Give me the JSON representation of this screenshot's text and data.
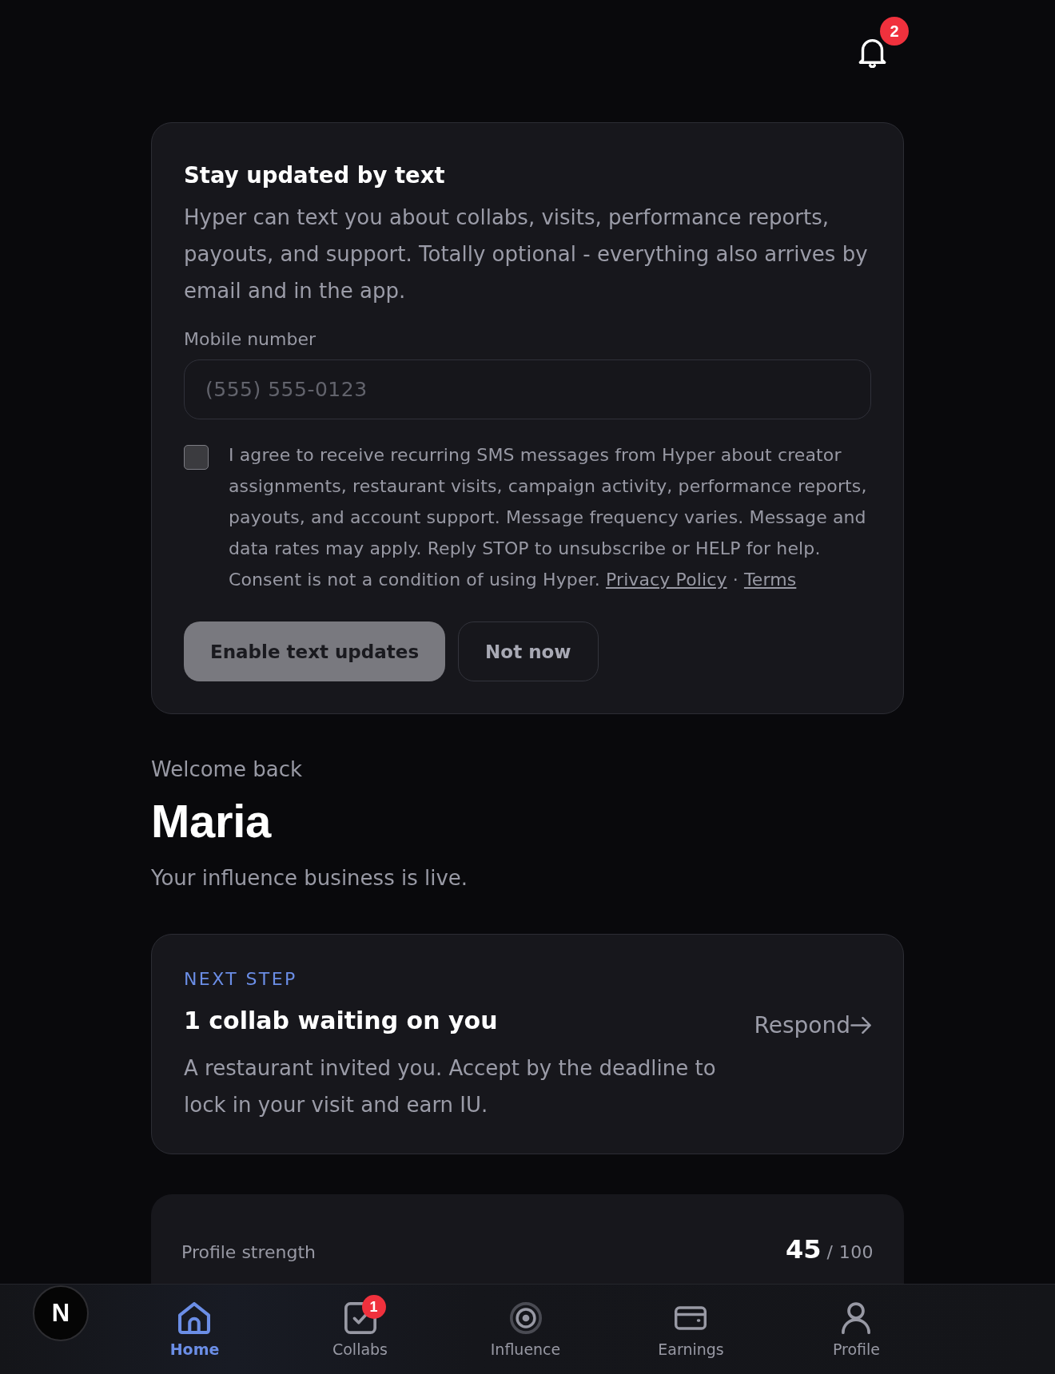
{
  "header": {
    "notifications": {
      "count": "2"
    }
  },
  "sms_card": {
    "title": "Stay updated by text",
    "description": "Hyper can text you about collabs, visits, performance reports, payouts, and support. Totally optional - everything also arrives by email and in the app.",
    "phone_field": {
      "label": "Mobile number",
      "placeholder": "(555) 555-0123"
    },
    "consent": {
      "checked": false,
      "text": "I agree to receive recurring SMS messages from Hyper about creator assignments, restaurant visits, campaign activity, performance reports, payouts, and account support. Message frequency varies. Message and data rates may apply. Reply STOP to unsubscribe or HELP for help. Consent is not a condition of using Hyper.",
      "links": [
        "Privacy Policy",
        "Terms"
      ],
      "separator": "·"
    },
    "buttons": [
      {
        "label": "Enable text updates",
        "kind": "primary",
        "disabled": true
      },
      {
        "label": "Not now",
        "kind": "secondary",
        "disabled": false
      }
    ]
  },
  "welcome": {
    "eyebrow": "Welcome back",
    "name": "Maria",
    "subtitle": "Your influence business is live."
  },
  "next_step": {
    "eyebrow": "NEXT STEP",
    "title": "1 collab waiting on you",
    "description": "A restaurant invited you. Accept by the deadline to lock in your visit and earn IU.",
    "action": "Respond"
  },
  "profile_strength": {
    "label": "Profile strength",
    "score": "45",
    "total": "/ 100"
  },
  "bottom_nav": {
    "dev_indicator": "N",
    "items": [
      {
        "label": "Home",
        "kind": "home",
        "selected": true
      },
      {
        "label": "Collabs",
        "kind": "collabs",
        "selected": false,
        "badge": "1"
      },
      {
        "label": "Influence",
        "kind": "influence",
        "selected": false
      },
      {
        "label": "Earnings",
        "kind": "earnings",
        "selected": false
      },
      {
        "label": "Profile",
        "kind": "profile",
        "selected": false
      }
    ]
  }
}
